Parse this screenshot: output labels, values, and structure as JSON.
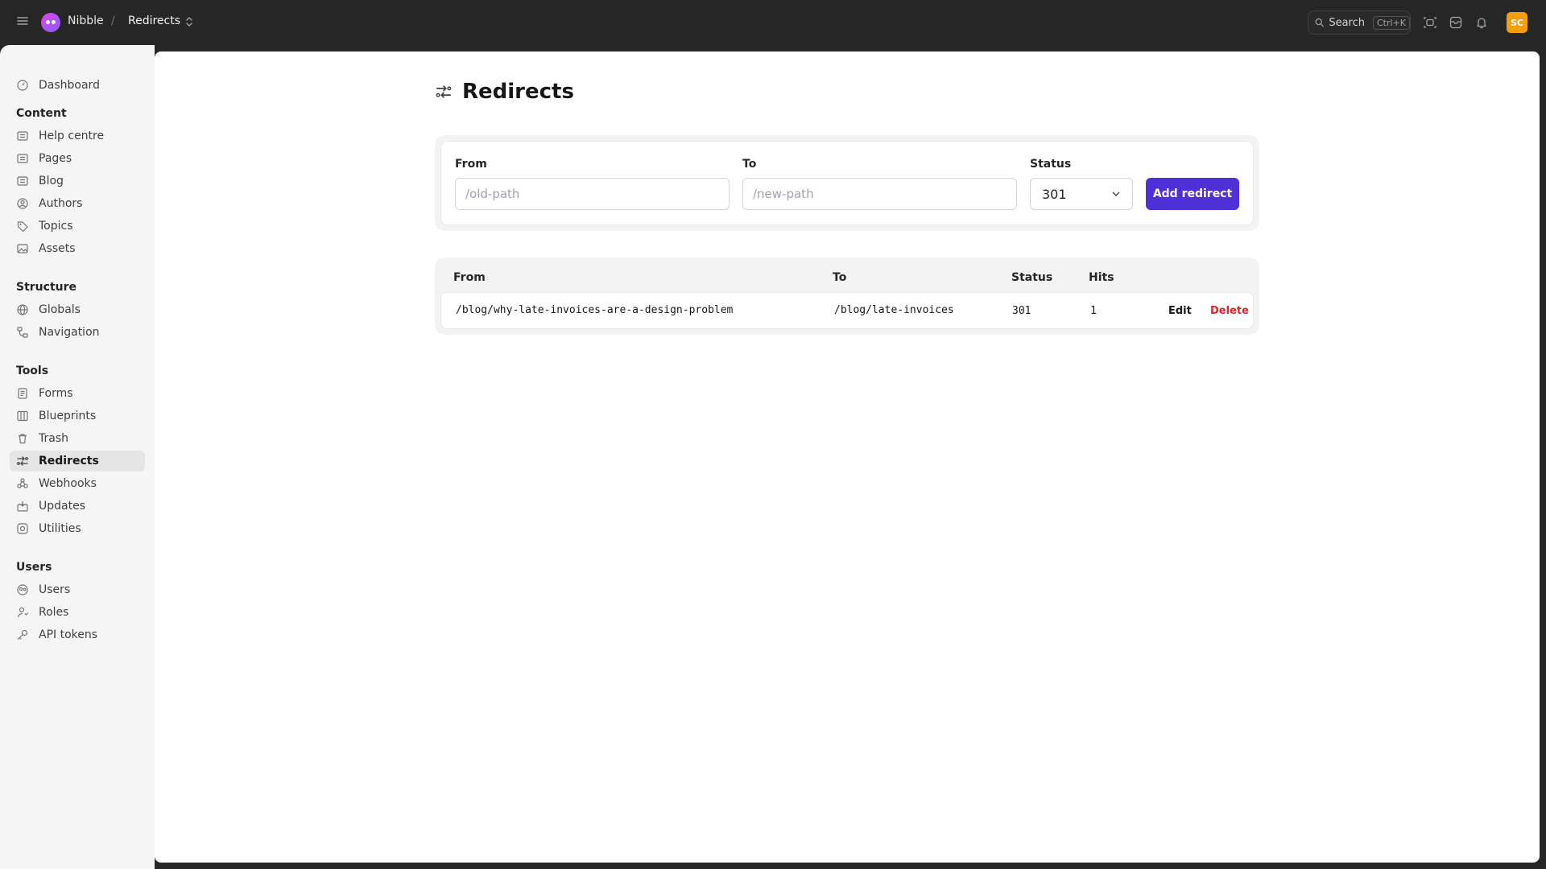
{
  "header": {
    "site_name": "Nibble",
    "separator": "/",
    "breadcrumb": "Redirects",
    "search_label": "Search",
    "search_shortcut": "Ctrl+K",
    "avatar_initials": "SC"
  },
  "sidebar": {
    "dashboard": "Dashboard",
    "sections": {
      "content": "Content",
      "structure": "Structure",
      "tools": "Tools",
      "users": "Users"
    },
    "content_items": [
      "Help centre",
      "Pages",
      "Blog",
      "Authors",
      "Topics",
      "Assets"
    ],
    "structure_items": [
      "Globals",
      "Navigation"
    ],
    "tools_items": [
      "Forms",
      "Blueprints",
      "Trash",
      "Redirects",
      "Webhooks",
      "Updates",
      "Utilities"
    ],
    "users_items": [
      "Users",
      "Roles",
      "API tokens"
    ],
    "active_item": "Redirects"
  },
  "page": {
    "title": "Redirects"
  },
  "form": {
    "from_label": "From",
    "from_placeholder": "/old-path",
    "to_label": "To",
    "to_placeholder": "/new-path",
    "status_label": "Status",
    "status_value": "301",
    "submit_label": "Add redirect"
  },
  "table": {
    "headers": {
      "from": "From",
      "to": "To",
      "status": "Status",
      "hits": "Hits"
    },
    "rows": [
      {
        "from": "/blog/why-late-invoices-are-a-design-problem",
        "to": "/blog/late-invoices",
        "status": "301",
        "hits": "1",
        "edit": "Edit",
        "delete": "Delete"
      }
    ]
  },
  "colors": {
    "accent": "#4f2fd6",
    "danger": "#dc2626",
    "topbar": "#262626",
    "avatar": "#f59e0b"
  }
}
